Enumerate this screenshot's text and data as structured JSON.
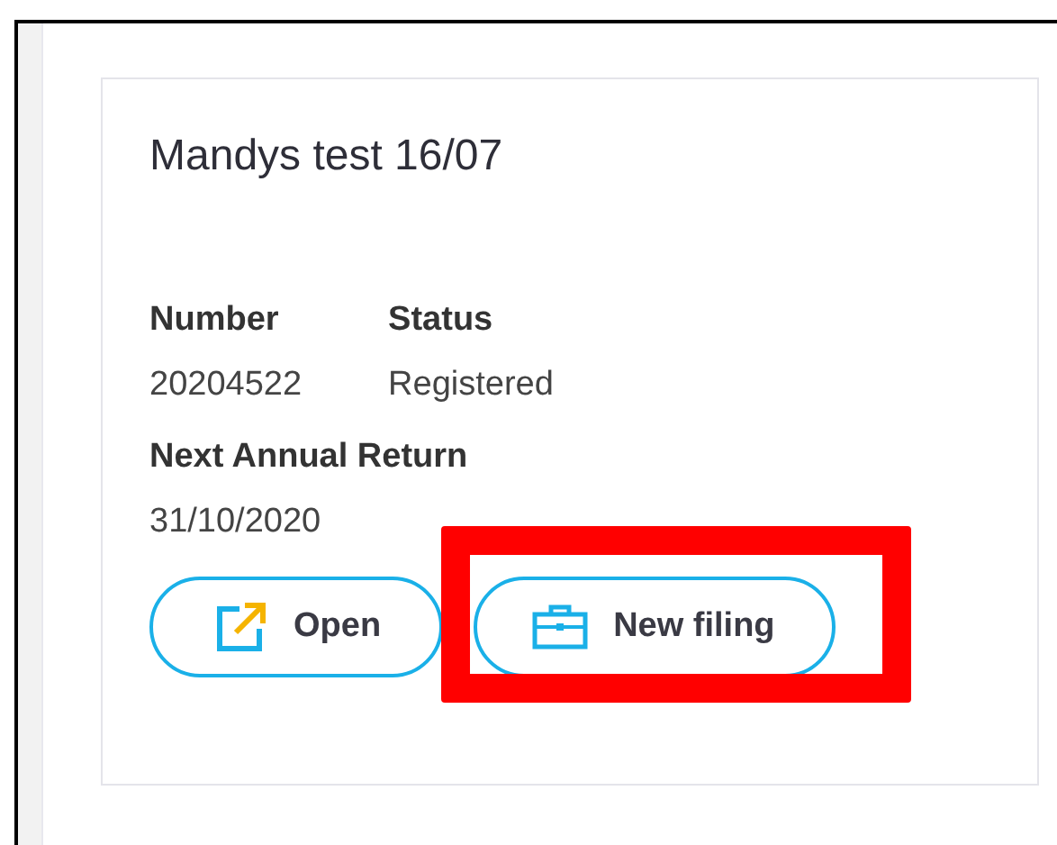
{
  "card": {
    "title": "Mandys test 16/07",
    "fields": [
      {
        "label": "Number",
        "value": "20204522"
      },
      {
        "label": "Status",
        "value": "Registered"
      }
    ],
    "next_return": {
      "label": "Next Annual Return",
      "value": "31/10/2020"
    },
    "buttons": [
      {
        "label": "Open",
        "kind": "open",
        "highlighted": false
      },
      {
        "label": "New filing",
        "kind": "filing",
        "highlighted": true
      }
    ]
  }
}
